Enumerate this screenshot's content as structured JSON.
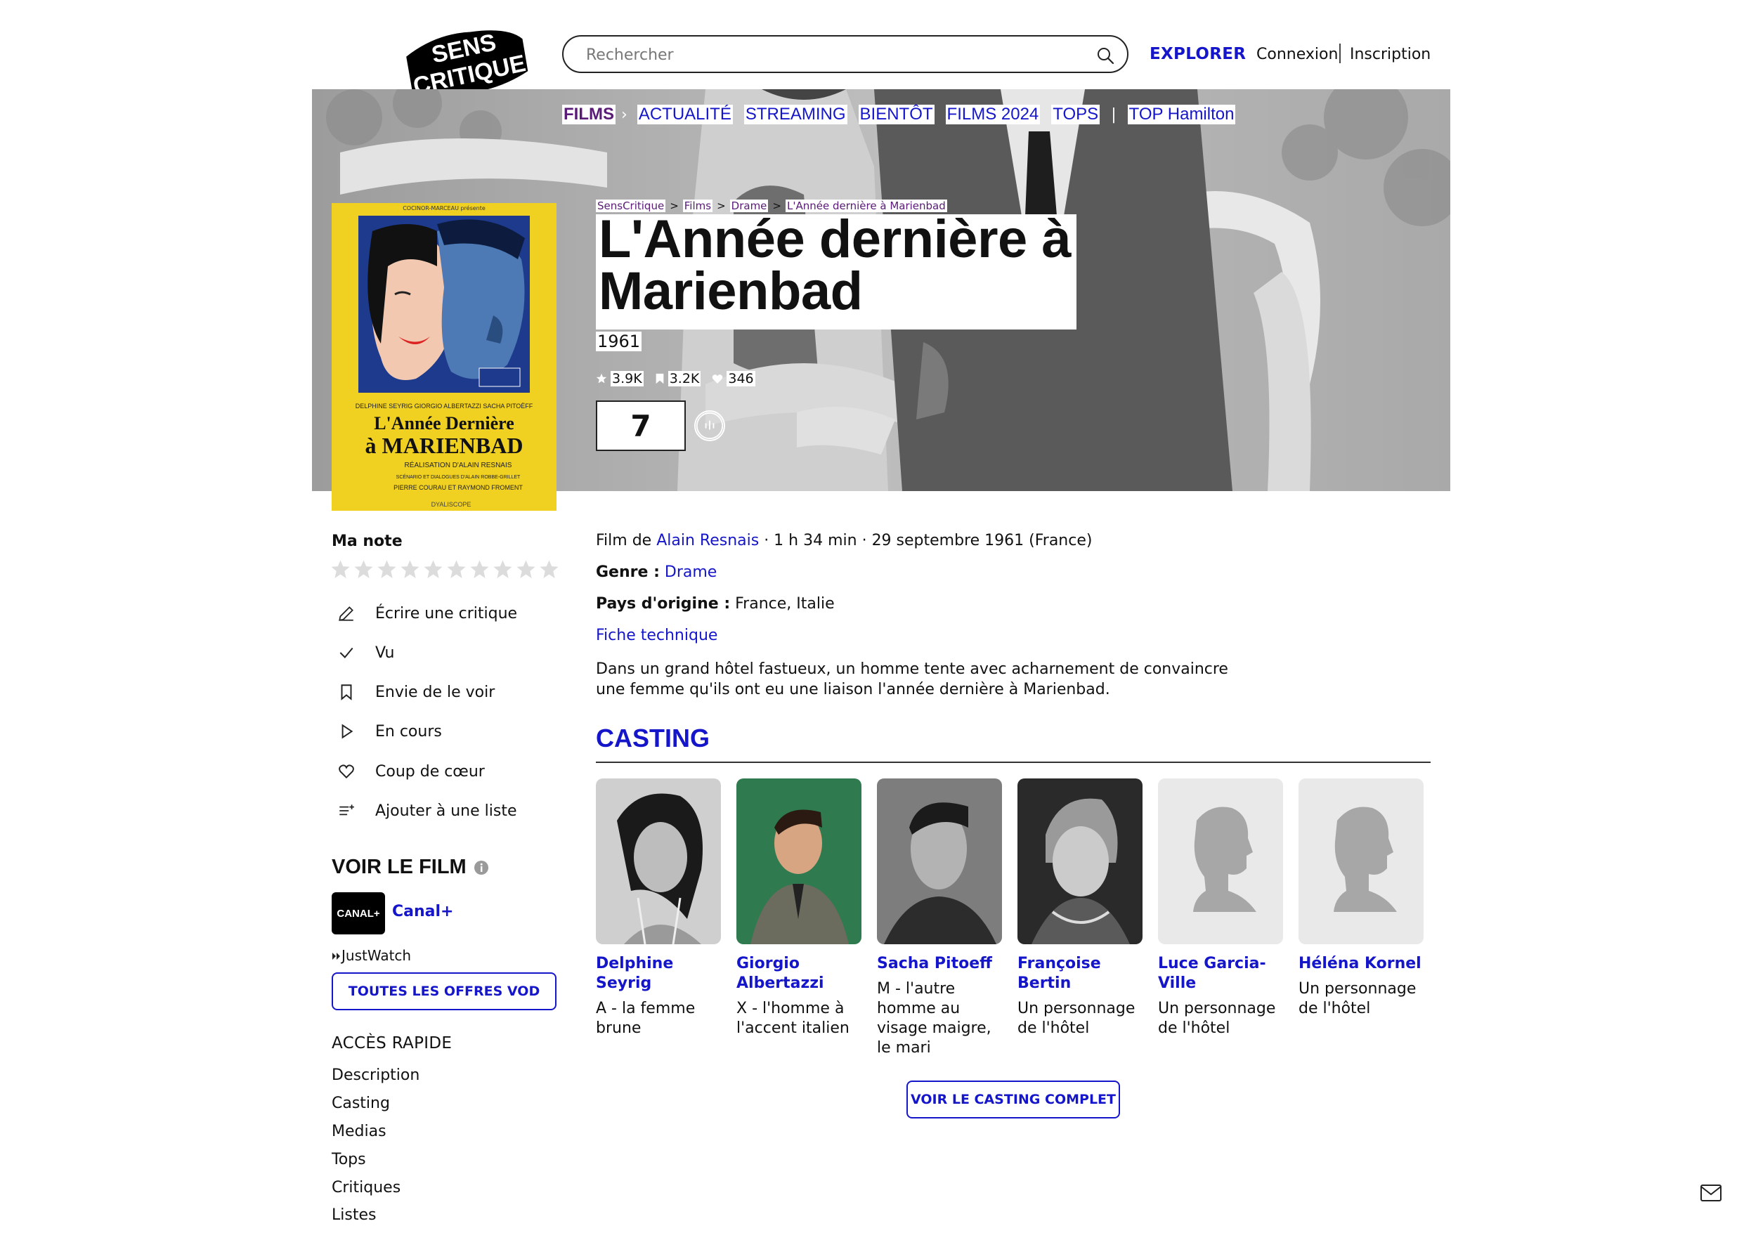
{
  "header": {
    "logo_text": "SENS CRITIQUE",
    "search_placeholder": "Rechercher",
    "explorer": "EXPLORER",
    "connexion": "Connexion",
    "inscription": "Inscription"
  },
  "subnav": {
    "active": "FILMS",
    "items": [
      "ACTUALITÉ",
      "STREAMING",
      "BIENTÔT",
      "FILMS 2024",
      "TOPS"
    ],
    "extra": "TOP Hamilton"
  },
  "breadcrumb": [
    "SensCritique",
    "Films",
    "Drame",
    "L'Année dernière à Marienbad"
  ],
  "movie": {
    "title": "L'Année dernière à Marienbad",
    "year": "1961",
    "stats": {
      "ratings": "3.9K",
      "wishes": "3.2K",
      "favorites": "346"
    },
    "score": "7",
    "director_prefix": "Film de ",
    "director": "Alain Resnais",
    "meta": " · 1 h 34 min · 29 septembre 1961 (France)",
    "genre_label": "Genre :",
    "genre": "Drame",
    "country_label": "Pays d'origine :",
    "country": "France, Italie",
    "fiche": "Fiche technique",
    "synopsis": "Dans un grand hôtel fastueux, un homme tente avec acharnement de convaincre une femme qu'ils ont eu une liaison l'année dernière à Marienbad."
  },
  "poster": {
    "top_text": "COCINOR-MARCEAU présente",
    "actors": "DELPHINE SEYRIG  GIORGIO ALBERTAZZI  SACHA PITOËFF",
    "title_line1": "L'Année Dernière",
    "title_line2": "à MARIENBAD",
    "credits1": "RÉALISATION D'ALAIN RESNAIS",
    "credits2": "SCÉNARIO ET DIALOGUES D'ALAIN ROBBE-GRILLET",
    "credits3": "PIERRE COURAU ET RAYMOND FROMENT",
    "bottom": "DYALISCOPE"
  },
  "sidebar": {
    "ma_note": "Ma note",
    "actions": [
      {
        "icon": "pencil-icon",
        "label": "Écrire une critique"
      },
      {
        "icon": "check-icon",
        "label": "Vu"
      },
      {
        "icon": "bookmark-icon",
        "label": "Envie de le voir"
      },
      {
        "icon": "play-icon",
        "label": "En cours"
      },
      {
        "icon": "heart-icon",
        "label": "Coup de cœur"
      },
      {
        "icon": "list-add-icon",
        "label": "Ajouter à une liste"
      }
    ],
    "voir_film": "VOIR LE FILM",
    "canal_logo": "CANAL+",
    "canal": "Canal+",
    "justwatch": "JustWatch",
    "vod_button": "TOUTES LES OFFRES VOD",
    "acces_rapide": "ACCÈS RAPIDE",
    "quick_links": [
      "Description",
      "Casting",
      "Medias",
      "Tops",
      "Critiques",
      "Listes"
    ]
  },
  "casting": {
    "title": "CASTING",
    "actors": [
      {
        "name": "Delphine Seyrig",
        "role": "A - la femme brune"
      },
      {
        "name": "Giorgio Albertazzi",
        "role": "X - l'homme à l'accent italien"
      },
      {
        "name": "Sacha Pitoeff",
        "role": "M - l'autre homme au visage maigre, le mari"
      },
      {
        "name": "Françoise Bertin",
        "role": "Un personnage de l'hôtel"
      },
      {
        "name": "Luce Garcia-Ville",
        "role": "Un personnage de l'hôtel"
      },
      {
        "name": "Héléna Kornel",
        "role": "Un personnage de l'hôtel"
      }
    ],
    "button": "VOIR LE CASTING COMPLET"
  },
  "colors": {
    "accent": "#1516c9",
    "visited": "#5a1a78",
    "hero_gray": "#b9b9b9"
  }
}
